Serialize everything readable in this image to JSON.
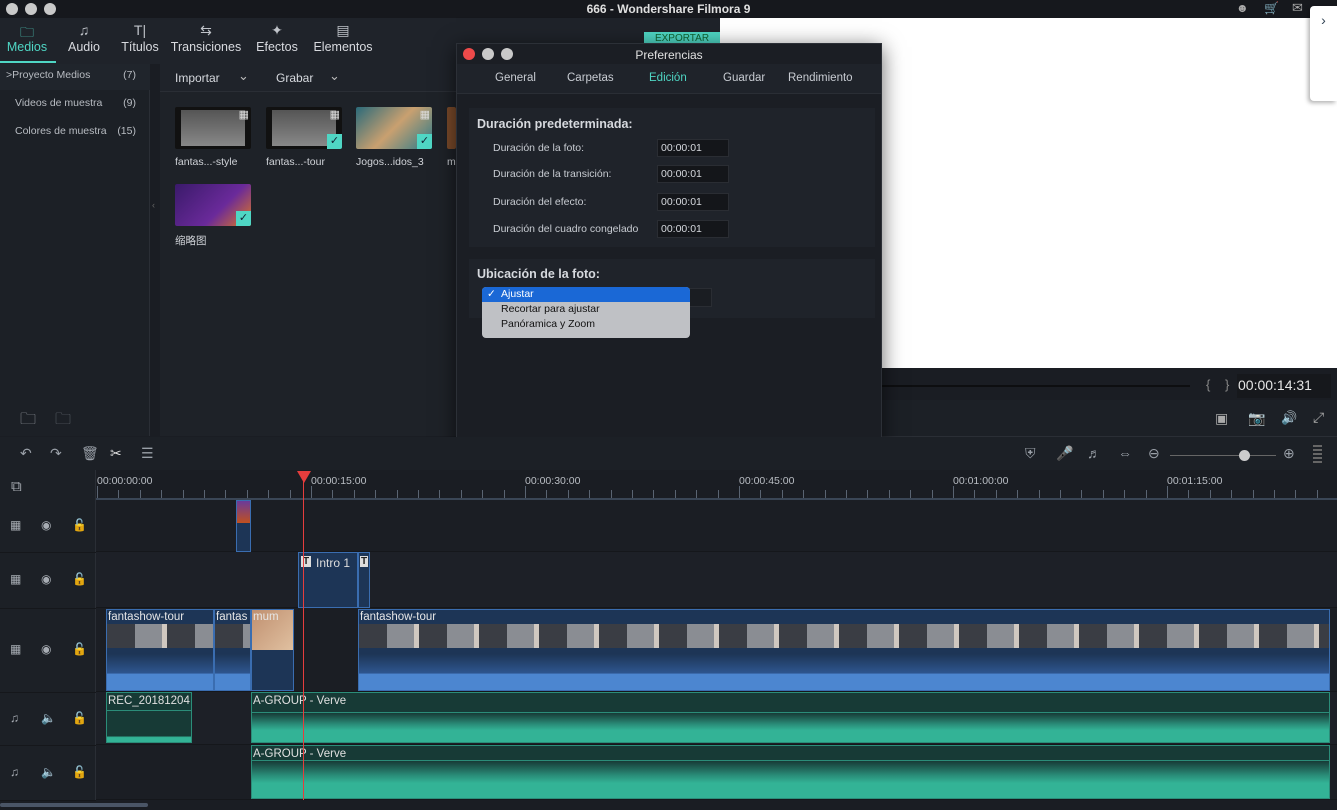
{
  "window": {
    "title": "666 - Wondershare Filmora 9"
  },
  "nav": {
    "tabs": [
      {
        "label": "Medios",
        "icon": "folder-icon",
        "active": true
      },
      {
        "label": "Audio",
        "icon": "music-note-icon"
      },
      {
        "label": "Títulos",
        "icon": "title-icon"
      },
      {
        "label": "Transiciones",
        "icon": "transition-icon"
      },
      {
        "label": "Efectos",
        "icon": "effects-icon"
      },
      {
        "label": "Elementos",
        "icon": "image-icon"
      }
    ]
  },
  "sidebar": {
    "items": [
      {
        "label": "Proyecto Medios",
        "count": "(7)",
        "chevron": ">"
      },
      {
        "label": "Videos de muestra",
        "count": "(9)"
      },
      {
        "label": "Colores de muestra",
        "count": "(15)"
      }
    ]
  },
  "media": {
    "import_label": "Importar",
    "record_label": "Grabar",
    "items": [
      {
        "label": "fantas...-style",
        "checked": false
      },
      {
        "label": "fantas...-tour",
        "checked": true
      },
      {
        "label": "Jogos...idos_3",
        "checked": true
      },
      {
        "label": "m",
        "checked": false
      },
      {
        "label": "缩略图",
        "checked": true
      }
    ]
  },
  "export_label": "EXPORTAR",
  "preview": {
    "timecode": "00:00:14:31",
    "brace_open": "{",
    "brace_close": "}"
  },
  "dialog": {
    "title": "Preferencias",
    "tabs": [
      "General",
      "Carpetas",
      "Edición",
      "Guardar",
      "Rendimiento"
    ],
    "active_tab": "Edición",
    "duration": {
      "heading": "Duración predeterminada:",
      "fields": [
        {
          "label": "Duración de la foto:",
          "value": "00:00:01"
        },
        {
          "label": "Duración de la transición:",
          "value": "00:00:01"
        },
        {
          "label": "Duración del efecto:",
          "value": "00:00:01"
        },
        {
          "label": "Duración del cuadro congelado",
          "value": "00:00:01"
        }
      ]
    },
    "photo": {
      "heading": "Ubicación de la foto:",
      "options": [
        "Ajustar",
        "Recortar para ajustar",
        "Panóramica y Zoom"
      ],
      "selected": "Ajustar",
      "check": "✓"
    }
  },
  "timeline": {
    "ruler": [
      "00:00:00:00",
      "00:00:15:00",
      "00:00:30:00",
      "00:00:45:00",
      "00:01:00:00",
      "00:01:15:00"
    ],
    "clips": {
      "title": "Intro 1",
      "video1": "fantashow-tour",
      "video2": "fantas",
      "video3": "mum",
      "video4": "fantashow-tour",
      "audio1": "REC_20181204",
      "audio2": "A-GROUP - Verve",
      "audio3": "A-GROUP - Verve"
    },
    "zoom_level": 0.7
  },
  "colors": {
    "accent": "#4fd6c4",
    "playhead": "#e53d3d",
    "video_clip": "#4c86d0",
    "audio_clip": "#33b396"
  }
}
